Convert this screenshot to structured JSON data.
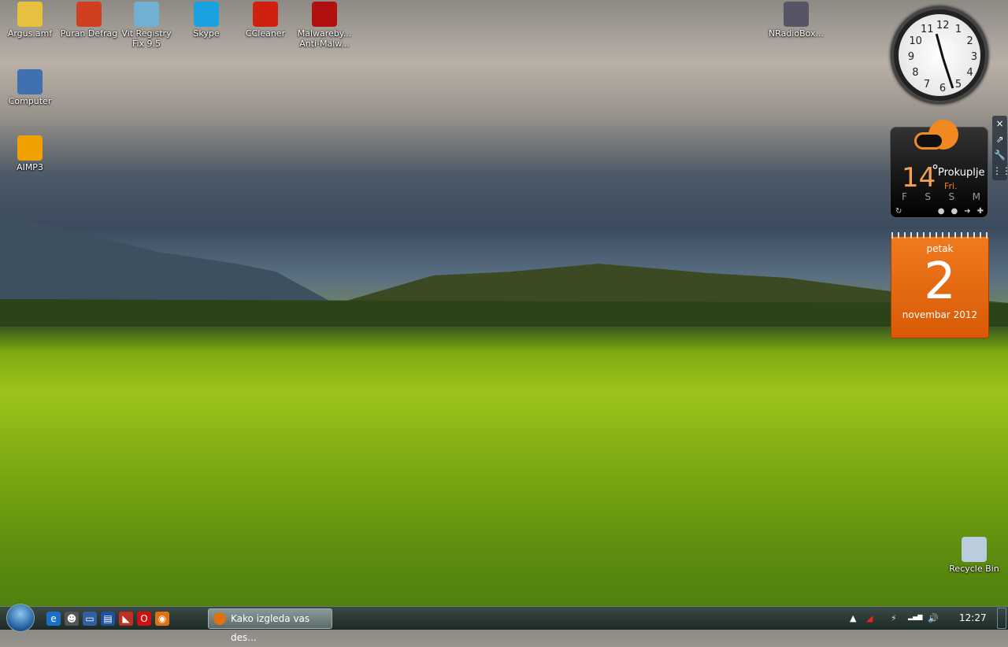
{
  "desktop_icons": [
    {
      "label": "Argus.amf",
      "icon": "folder-icon",
      "color": "#e8c040"
    },
    {
      "label": "Puran Defrag",
      "icon": "defrag-icon",
      "color": "#d04020"
    },
    {
      "label": "Vit Registry Fix 9.5",
      "icon": "registry-icon",
      "color": "#70b0d0"
    },
    {
      "label": "Skype",
      "icon": "skype-icon",
      "color": "#1ba0e1"
    },
    {
      "label": "CCleaner",
      "icon": "ccleaner-icon",
      "color": "#d02010"
    },
    {
      "label": "Malwareby... Anti-Malw...",
      "icon": "malwarebytes-icon",
      "color": "#b01010"
    },
    {
      "label": "NRadioBox...",
      "icon": "speaker-icon",
      "color": "#556"
    },
    {
      "label": "Computer",
      "icon": "computer-icon",
      "color": "#4070b0"
    },
    {
      "label": "AIMP3",
      "icon": "aimp-icon",
      "color": "#f0a000"
    },
    {
      "label": "Recycle Bin",
      "icon": "recycle-bin-icon",
      "color": "#bcd"
    }
  ],
  "clock": {
    "numbers": [
      "12",
      "1",
      "2",
      "3",
      "4",
      "5",
      "6",
      "7",
      "8",
      "9",
      "10",
      "11"
    ]
  },
  "weather": {
    "temp": "14",
    "deg": "°",
    "city": "Prokuplje",
    "day": "Fri.",
    "forecast_days": [
      "F",
      "S",
      "S",
      "M"
    ]
  },
  "calendar": {
    "weekday": "petak",
    "day": "2",
    "month_year": "novembar 2012"
  },
  "gadget_controls": [
    "×",
    "⇗",
    "🔧",
    "⋮⋮"
  ],
  "taskbar": {
    "quick_launch": [
      {
        "icon": "ie-icon",
        "glyph": "e",
        "color": "#1a70c8"
      },
      {
        "icon": "messenger-icon",
        "glyph": "☻",
        "color": "#555"
      },
      {
        "icon": "show-desktop-icon",
        "glyph": "▭",
        "color": "#3060a0"
      },
      {
        "icon": "switch-windows-icon",
        "glyph": "▤",
        "color": "#2050a0"
      },
      {
        "icon": "app-icon",
        "glyph": "◣",
        "color": "#c03020"
      },
      {
        "icon": "opera-icon",
        "glyph": "O",
        "color": "#d01010"
      },
      {
        "icon": "firefox-icon",
        "glyph": "◉",
        "color": "#e07010"
      }
    ],
    "task_label": "Kako izgleda vas des...",
    "time": "12:27",
    "tray": [
      "▲",
      "◢",
      "⚡",
      "▂▄▆",
      "🔊"
    ]
  }
}
